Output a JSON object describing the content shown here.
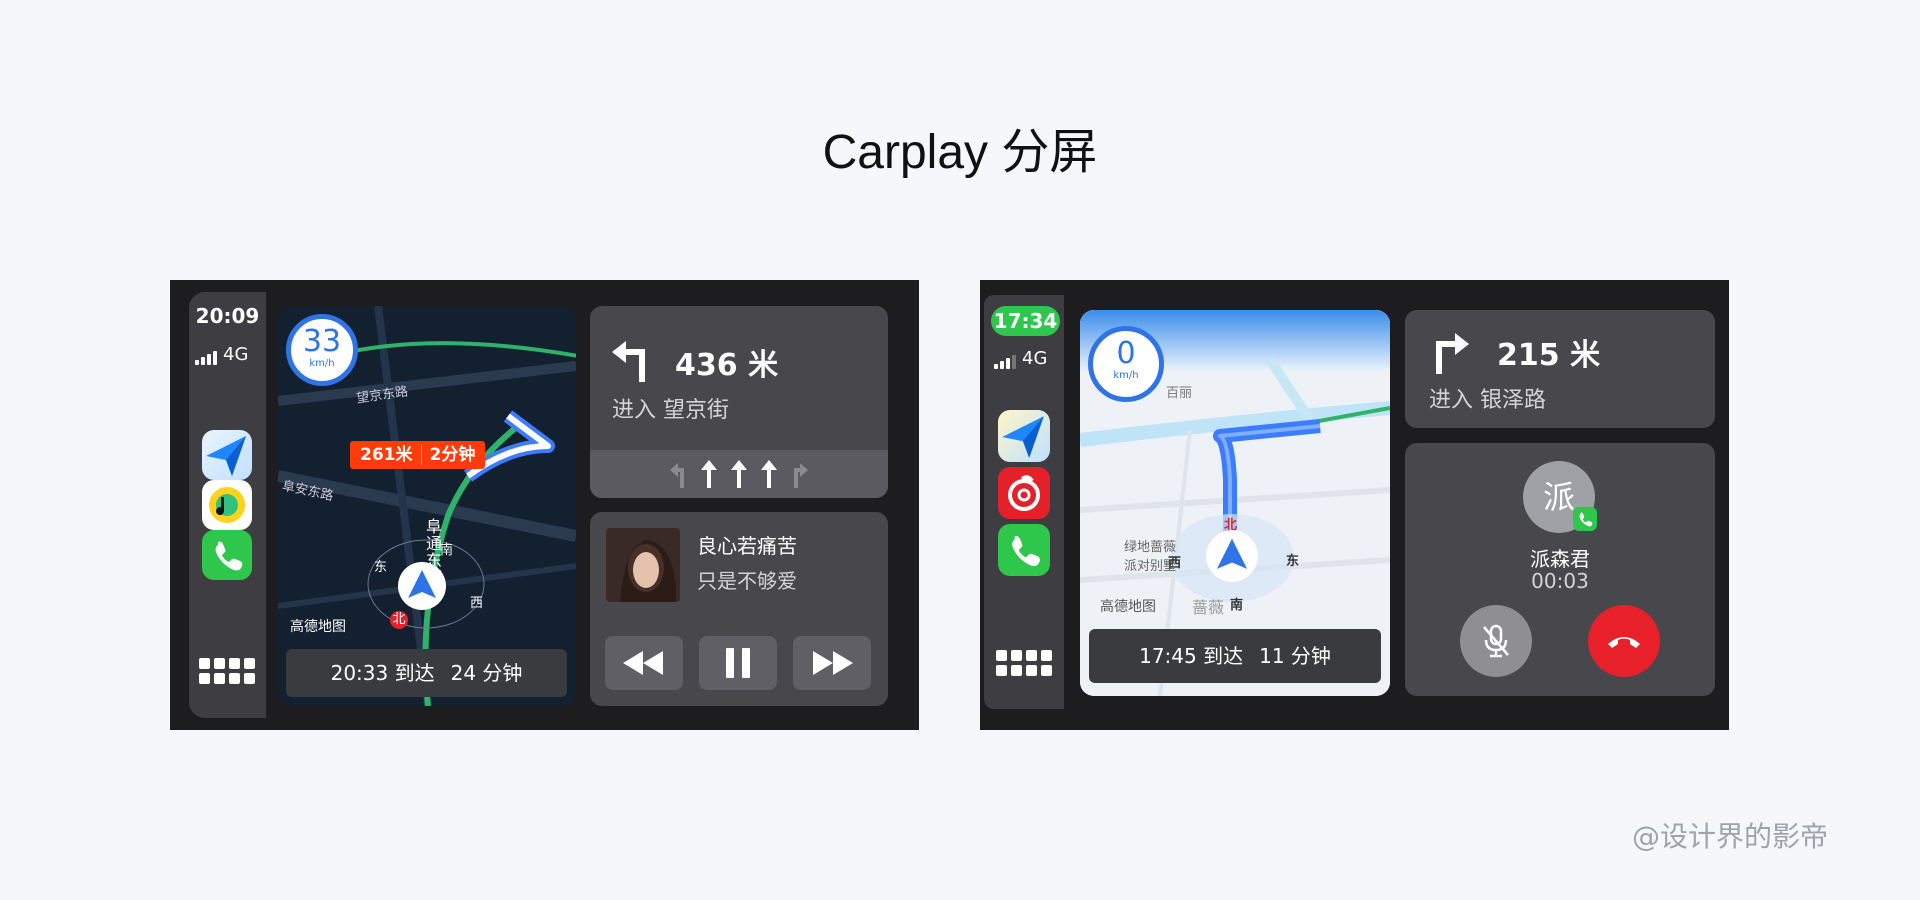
{
  "page": {
    "title": "Carplay 分屏",
    "watermark": "@设计界的影帝"
  },
  "screen1": {
    "status": {
      "time": "20:09",
      "network": "4G"
    },
    "dock_apps": [
      "amap-icon",
      "qq-music-icon",
      "phone-icon"
    ],
    "map": {
      "speed": "33",
      "speed_unit": "km/h",
      "route_badge": {
        "distance": "261米",
        "time": "2分钟"
      },
      "streets": [
        "望京东路",
        "阜安东路",
        "阜通东街"
      ],
      "compass": {
        "east": "东",
        "west": "西",
        "south": "南",
        "north": "北"
      },
      "brand": "高德地图",
      "eta": {
        "arrival": "20:33 到达",
        "remaining": "24 分钟"
      }
    },
    "nav": {
      "distance": "436 米",
      "street": "进入 望京街",
      "lanes": [
        "slight-left",
        "straight",
        "straight",
        "straight",
        "slight-right"
      ]
    },
    "media": {
      "song": "良心若痛苦",
      "artist": "只是不够爱",
      "controls": [
        "rewind-icon",
        "pause-icon",
        "fast-forward-icon"
      ]
    }
  },
  "screen2": {
    "status": {
      "time": "17:34",
      "network": "4G",
      "time_color": "#2fc64c"
    },
    "dock_apps": [
      "amap-icon",
      "netease-music-icon",
      "phone-icon"
    ],
    "map": {
      "speed": "0",
      "speed_unit": "km/h",
      "pois": [
        "百丽",
        "绿地蔷薇 派对别墅",
        "蔷薇"
      ],
      "compass": {
        "east": "东",
        "west": "西",
        "south": "南",
        "north": "北"
      },
      "brand": "高德地图",
      "eta": {
        "arrival": "17:45 到达",
        "remaining": "11 分钟"
      }
    },
    "nav": {
      "distance": "215 米",
      "street": "进入 银泽路"
    },
    "call": {
      "avatar_char": "派",
      "name": "派森君",
      "duration": "00:03",
      "hangup_color": "#e8202a"
    }
  }
}
